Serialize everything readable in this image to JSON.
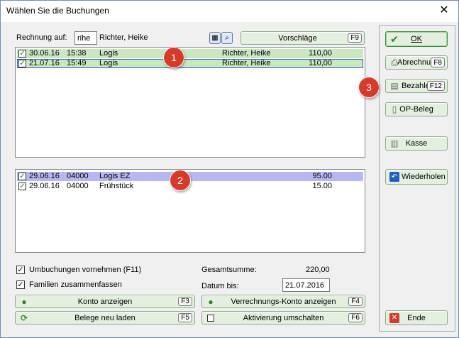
{
  "window": {
    "title": "Wählen Sie die Buchungen",
    "close_glyph": "✕"
  },
  "invoice": {
    "label": "Rechnung auf:",
    "code_value": "rihe",
    "name": "Richter, Heike",
    "suggestions_label": "Vorschläge",
    "suggestions_key": "F9"
  },
  "top_list": {
    "rows": [
      {
        "checked": true,
        "date": "30.06.16",
        "time": "15:38",
        "text": "Logis",
        "name": "Richter, Heike",
        "amount": "110,00"
      },
      {
        "checked": true,
        "date": "21.07.16",
        "time": "15:49",
        "text": "Logis",
        "name": "Richter, Heike",
        "amount": "110,00"
      }
    ]
  },
  "bottom_list": {
    "rows": [
      {
        "checked": true,
        "date": "29.06.16",
        "code": "04000",
        "text": "Logis EZ",
        "amount": "95.00"
      },
      {
        "checked": true,
        "date": "29.06.16",
        "code": "04000",
        "text": "Frühstück",
        "amount": "15.00"
      }
    ]
  },
  "badges": [
    "1",
    "2",
    "3"
  ],
  "options": {
    "umbuchungen_label": "Umbuchungen vornehmen (F11)",
    "familien_label": "Familien zusammenfassen",
    "umbuchungen_checked": true,
    "familien_checked": true
  },
  "totals": {
    "sum_label": "Gesamtsumme:",
    "sum_value": "220,00",
    "date_label": "Datum bis:",
    "date_value": "21.07.2016"
  },
  "bottom_buttons": {
    "konto_label": "Konto anzeigen",
    "konto_key": "F3",
    "verrechnung_label": "Verrechnungs-Konto anzeigen",
    "verrechnung_key": "F4",
    "belege_label": "Belege neu laden",
    "belege_key": "F5",
    "aktivierung_label": "Aktivierung umschalten",
    "aktivierung_key": "F6"
  },
  "side_buttons": {
    "ok_label": "OK",
    "abrechnung_label": "Abrechnung",
    "abrechnung_key": "F8",
    "bezahlen_label": "Bezahlen",
    "bezahlen_key": "F12",
    "opbeleg_label": "OP-Beleg",
    "kasse_label": "Kasse",
    "wiederholen_label": "Wiederholen",
    "ende_label": "Ende"
  },
  "colors": {
    "row_selected_green": "#c9e8c0",
    "row_selected_purple": "#b7b7f2",
    "badge_red": "#d63a2a",
    "button_face": "#e4efe0"
  },
  "icons": {
    "ok": "checkmark-icon",
    "abrechnung": "printer-icon",
    "bezahlen": "cash-icon",
    "opbeleg": "document-icon",
    "kasse": "cash-register-icon",
    "wiederholen": "undo-icon",
    "ende": "close-icon",
    "konto": "account-icon",
    "belege": "refresh-icon",
    "verrechnung": "account-icon",
    "aktivierung": "checkbox-icon",
    "calc": "calculator-icon",
    "search": "search-icon"
  }
}
